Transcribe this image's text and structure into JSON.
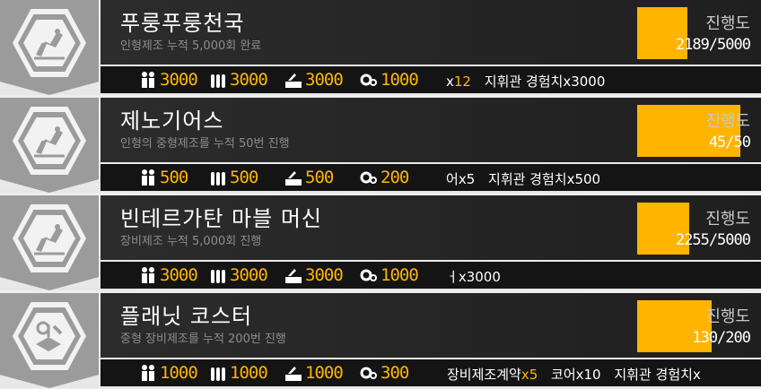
{
  "cards": [
    {
      "title": "푸룽푸룽천국",
      "subtitle": "인형제조 누적 5,000회 완료",
      "progress_label": "진행도",
      "progress_value": "2189/5000",
      "progress_fraction": 0.4378,
      "icon": "doll-production-icon",
      "resources": {
        "manpower": "3000",
        "ammo": "3000",
        "rations": "3000",
        "parts": "1000"
      },
      "extra_rewards": [
        {
          "prefix": "x",
          "count": "12"
        },
        {
          "name": "지휘관 경험치",
          "count": "x3000"
        }
      ]
    },
    {
      "title": "제노기어스",
      "subtitle": "인형의 중형제조를 누적 50번 진행",
      "progress_label": "진행도",
      "progress_value": "45/50",
      "progress_fraction": 0.9,
      "icon": "doll-production-icon",
      "resources": {
        "manpower": "500",
        "ammo": "500",
        "rations": "500",
        "parts": "200"
      },
      "extra_rewards": [
        {
          "name": "어",
          "count": "x5"
        },
        {
          "name": "지휘관 경험치",
          "count": "x500"
        }
      ]
    },
    {
      "title": "빈테르가탄 마블 머신",
      "subtitle": "장비제조 누적 5,000회 진행",
      "progress_label": "진행도",
      "progress_value": "2255/5000",
      "progress_fraction": 0.451,
      "icon": "doll-production-icon",
      "resources": {
        "manpower": "3000",
        "ammo": "3000",
        "rations": "3000",
        "parts": "1000"
      },
      "extra_rewards": [
        {
          "name": "ㅓ",
          "count": "x3000"
        }
      ]
    },
    {
      "title": "플래닛 코스터",
      "subtitle": "중형 장비제조를 누적 200번 진행",
      "progress_label": "진행도",
      "progress_value": "130/200",
      "progress_fraction": 0.65,
      "icon": "equipment-production-icon",
      "resources": {
        "manpower": "1000",
        "ammo": "1000",
        "rations": "1000",
        "parts": "300"
      },
      "extra_rewards": [
        {
          "name": "장비제조계약",
          "count": "x5"
        },
        {
          "name": "코어",
          "count": "x10"
        },
        {
          "name": "지휘관 경험치",
          "count": "x"
        }
      ]
    }
  ],
  "colors": {
    "accent": "#ffb400",
    "title_bg": "#2c2c2c",
    "reward_bg": "#141414",
    "banner": "#9b9b9b"
  }
}
